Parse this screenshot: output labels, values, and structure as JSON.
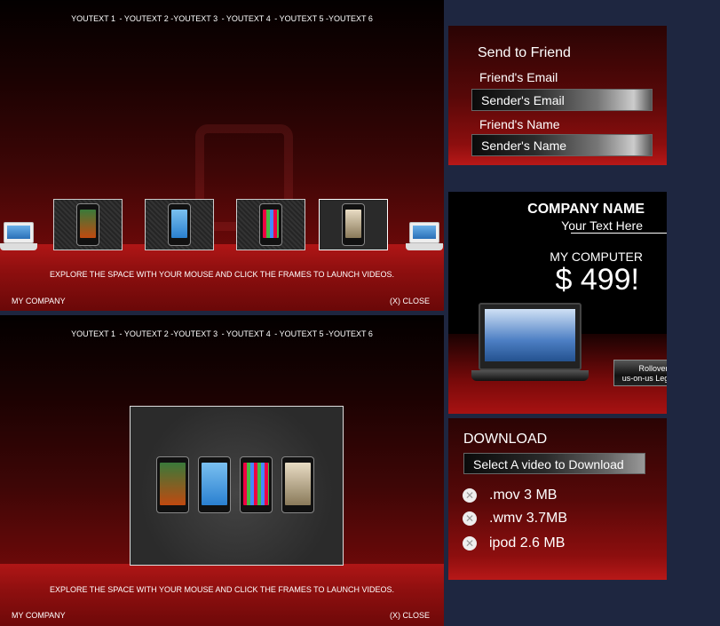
{
  "nav": [
    "YOUTEXT 1",
    "- YOUTEXT 2 -YOUTEXT 3",
    "- YOUTEXT 4",
    "- YOUTEXT 5 -YOUTEXT 6"
  ],
  "panel": {
    "instruction": "EXPLORE THE SPACE WITH YOUR MOUSE AND CLICK THE FRAMES TO LAUNCH VIDEOS.",
    "company": "MY COMPANY",
    "close": "(X) CLOSE"
  },
  "send": {
    "title": "Send to Friend",
    "friend_email": "Friend's Email",
    "sender_email": "Sender's Email",
    "friend_name": "Friend's Name",
    "sender_name": "Sender's Name"
  },
  "promo": {
    "company": "COMPANY NAME",
    "tagline": "Your Text Here",
    "product": "MY COMPUTER",
    "price": "$ 499!",
    "rollover_line1": "Rollover For",
    "rollover_line2": "us-on-us Legal Action"
  },
  "download": {
    "title": "DOWNLOAD",
    "select": "Select A video to Download",
    "options": [
      ".mov 3 MB",
      ".wmv 3.7MB",
      "ipod 2.6 MB"
    ]
  },
  "colors": {
    "page_bg": "#1e2640",
    "red": "#8a0c0c",
    "white": "#ffffff"
  }
}
